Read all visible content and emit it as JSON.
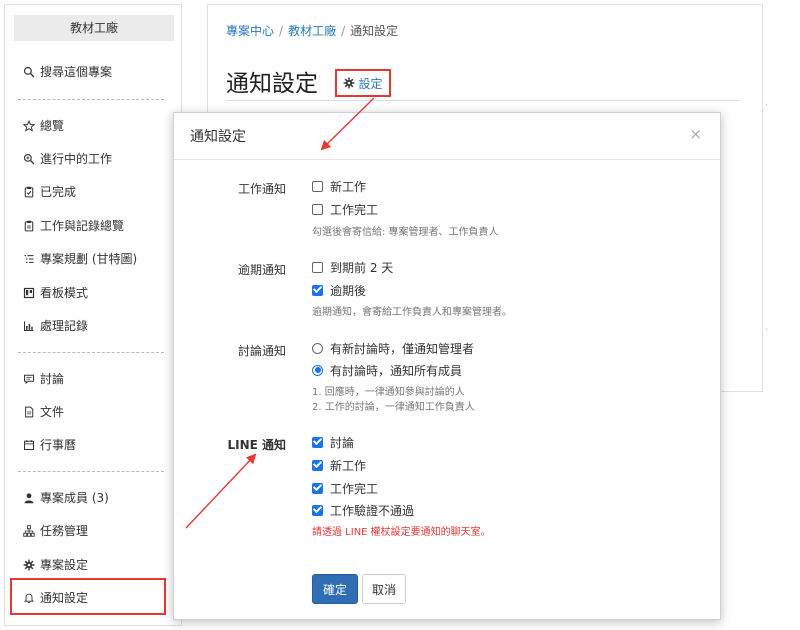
{
  "sidebar": {
    "title": "教材工廠",
    "search": "搜尋這個專案",
    "items": [
      {
        "label": "總覽",
        "icon": "star-icon"
      },
      {
        "label": "進行中的工作",
        "icon": "search-progress-icon"
      },
      {
        "label": "已完成",
        "icon": "clipboard-check-icon"
      },
      {
        "label": "工作與記錄總覽",
        "icon": "clipboard-icon"
      },
      {
        "label": "專案規劃 (甘特圖)",
        "icon": "list-icon"
      },
      {
        "label": "看板模式",
        "icon": "board-icon"
      },
      {
        "label": "處理記錄",
        "icon": "chart-icon"
      },
      {
        "label": "討論",
        "icon": "comment-icon"
      },
      {
        "label": "文件",
        "icon": "file-icon"
      },
      {
        "label": "行事曆",
        "icon": "calendar-icon"
      },
      {
        "label": "專案成員 (3)",
        "icon": "user-icon"
      },
      {
        "label": "任務管理",
        "icon": "sitemap-icon"
      },
      {
        "label": "專案設定",
        "icon": "gear-icon"
      },
      {
        "label": "通知設定",
        "icon": "bell-icon"
      }
    ]
  },
  "breadcrumb": {
    "items": [
      "專案中心",
      "教材工廠"
    ],
    "current": "通知設定",
    "sep": "/"
  },
  "page": {
    "title": "通知設定",
    "settings_link": "設定"
  },
  "modal": {
    "title": "通知設定",
    "close": "×",
    "sections": {
      "work": {
        "label": "工作通知",
        "options": [
          {
            "label": "新工作",
            "checked": false
          },
          {
            "label": "工作完工",
            "checked": false
          }
        ],
        "hint": "勾選後會寄信給: 專案管理者、工作負責人"
      },
      "overdue": {
        "label": "逾期通知",
        "options": [
          {
            "label": "到期前 2 天",
            "checked": false
          },
          {
            "label": "逾期後",
            "checked": true
          }
        ],
        "hint": "逾期通知，會寄給工作負責人和專案管理者。"
      },
      "discussion": {
        "label": "討論通知",
        "options": [
          {
            "label": "有新討論時，僅通知管理者",
            "checked": false
          },
          {
            "label": "有討論時，通知所有成員",
            "checked": true
          }
        ],
        "hint1": "1. 回應時，一律通知參與討論的人",
        "hint2": "2. 工作的討論，一律通知工作負責人"
      },
      "line": {
        "label": "LINE 通知",
        "options": [
          {
            "label": "討論",
            "checked": true
          },
          {
            "label": "新工作",
            "checked": true
          },
          {
            "label": "工作完工",
            "checked": true
          },
          {
            "label": "工作驗證不通過",
            "checked": true
          }
        ],
        "warning": "請透過 LINE 權杖設定要通知的聊天室。"
      }
    },
    "ok": "確定",
    "cancel": "取消"
  },
  "colors": {
    "accent": "#2f6db5",
    "link": "#2a7ab8",
    "highlight": "#e53935"
  }
}
